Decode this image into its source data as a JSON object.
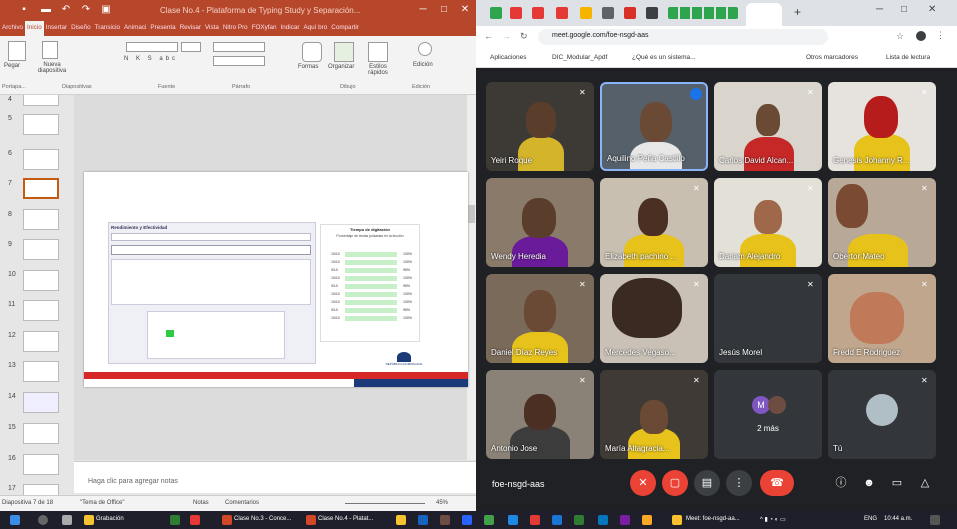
{
  "ppt": {
    "title": "Clase No.4 - Plataforma de Typing Study y Separación...",
    "tabs": [
      "Archivo",
      "Inicio",
      "Insertar",
      "Diseño",
      "Transicio",
      "Animaci",
      "Presenta",
      "Revisar",
      "Vista",
      "Nitro Pro",
      "FOXyfan",
      "Indicar",
      "Aquí bro",
      "Compartir"
    ],
    "active_tab": "Inicio",
    "ribbon": {
      "groups": [
        "Portapa...",
        "Diapositivas",
        "Fuente",
        "Párrafo",
        "Dibujo",
        "Edición"
      ],
      "new_slide": "Nueva diapositiva",
      "shapes": "Formas",
      "arrange": "Organizar",
      "quick_styles": "Estilos rápidos",
      "editing": "Edición",
      "paste": "Pegar"
    },
    "thumb_numbers": [
      "4",
      "5",
      "6",
      "7",
      "8",
      "9",
      "10",
      "11",
      "12",
      "13",
      "14",
      "15",
      "16",
      "17"
    ],
    "selected_thumb": "7",
    "notes_placeholder": "Haga clic para agregar notas",
    "status": {
      "slide_of": "Diapositiva 7 de 18",
      "theme": "\"Tema de Office\"",
      "notes": "Notas",
      "comments": "Comentarios",
      "zoom": "45%"
    },
    "slide": {
      "left_title": "Rendimiento y Efectividad",
      "right_title": "Tiempo de digitación",
      "right_subtitle": "Porcentaje de teclas pulsadas en la lección",
      "rows": [
        "10/10",
        "10/10",
        "9/10",
        "10/10",
        "9/10",
        "10/10",
        "10/10",
        "9/10",
        "10/10"
      ],
      "pct": [
        "100%",
        "100%",
        "95%",
        "100%",
        "95%",
        "100%",
        "100%",
        "95%",
        "100%"
      ],
      "footer": "REPÚBLICA DOMINICANA"
    }
  },
  "chrome": {
    "url": "meet.google.com/foe-nsgd-aas",
    "bookmarks": [
      "Aplicaciones",
      "DIC_Modular_Apdf",
      "¿Qué es un sistema...",
      "Otros marcadores",
      "Lista de lectura"
    ],
    "meeting_code": "foe-nsgd-aas",
    "participants": [
      {
        "name": "Yeiri Roque"
      },
      {
        "name": "Aquilino Peña Castillo"
      },
      {
        "name": "Carlos David Alcan..."
      },
      {
        "name": "Genesis Johanny R..."
      },
      {
        "name": "Wendy Heredia"
      },
      {
        "name": "Elizabeth pachino ..."
      },
      {
        "name": "Dariam Alejandro"
      },
      {
        "name": "Obertor Mateo"
      },
      {
        "name": "Daniel Díaz Reyes"
      },
      {
        "name": "Mercedes Vegaso..."
      },
      {
        "name": "Jesús Morel"
      },
      {
        "name": "Fredd E Rodriguez"
      },
      {
        "name": "Antonio Jose"
      },
      {
        "name": "María Altagracia..."
      },
      {
        "name": "2 más",
        "avatar": "M"
      },
      {
        "name": "Tú"
      }
    ]
  },
  "taskbar": {
    "items": [
      "Grabación",
      "Clase No.3 - Conce...",
      "Clase No.4 - Platat...",
      "Meet: foe-nsgd-aa..."
    ],
    "lang": "ENG",
    "time": "10:44 a.m."
  }
}
